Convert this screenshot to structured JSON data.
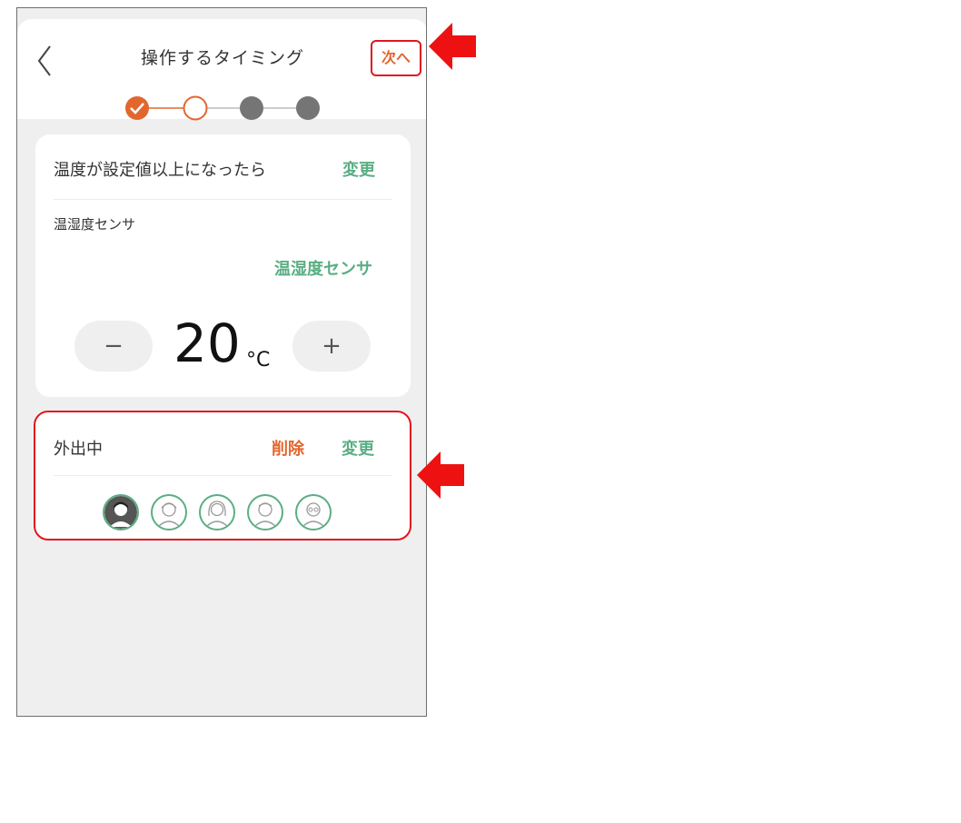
{
  "header": {
    "title": "操作するタイミング",
    "next_label": "次へ"
  },
  "stepper": {
    "steps": [
      "done",
      "current",
      "pending",
      "pending"
    ],
    "accent": "#e3662e",
    "pending_color": "#757575"
  },
  "condition_card": {
    "title": "温度が設定値以上になったら",
    "change_label": "変更",
    "sensor_section_label": "温湿度センサ",
    "sensor_link": "温湿度センサ",
    "minus_label": "−",
    "plus_label": "+",
    "temperature_value": "20",
    "temperature_unit": "°C"
  },
  "away_card": {
    "title": "外出中",
    "delete_label": "削除",
    "change_label": "変更",
    "members": [
      "member-1",
      "member-2",
      "member-3",
      "member-4",
      "member-5"
    ]
  },
  "colors": {
    "green": "#5aae83",
    "orange": "#e3662e",
    "highlight_red": "#e0171e"
  }
}
